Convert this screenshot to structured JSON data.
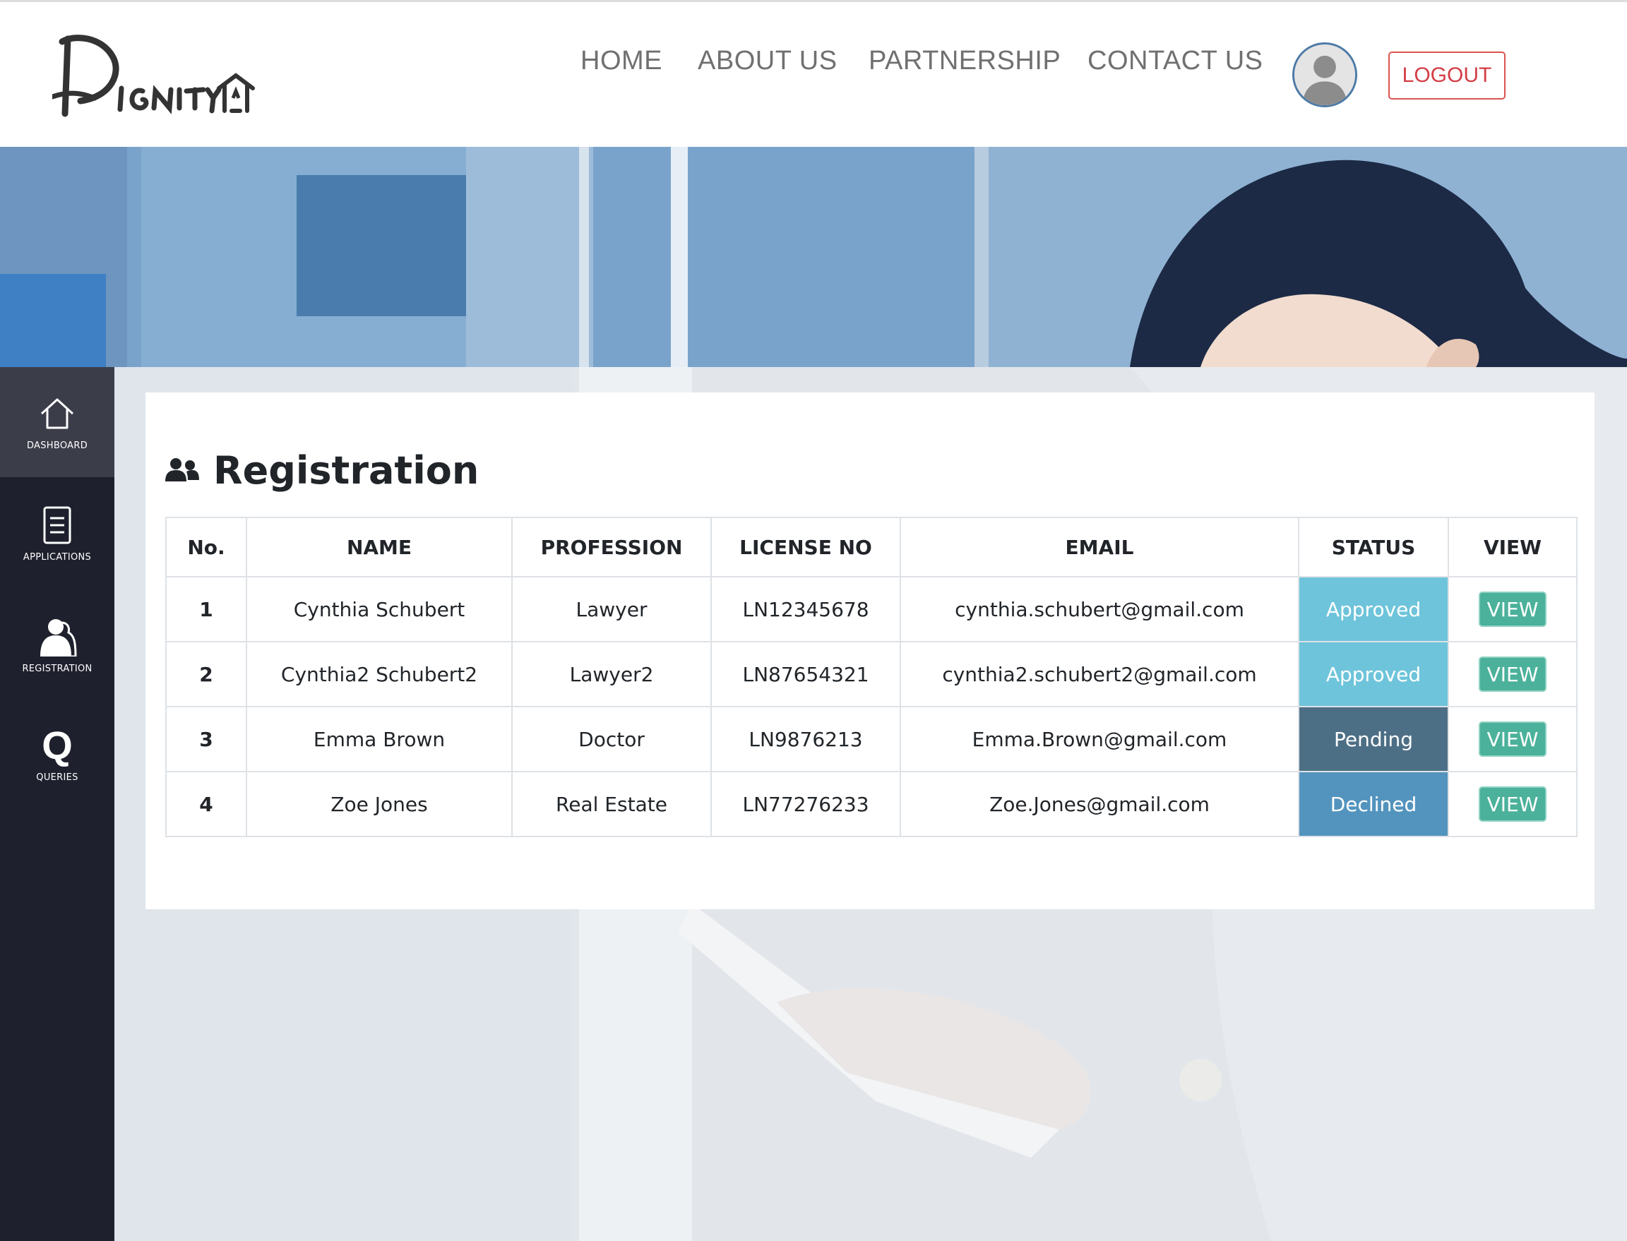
{
  "brand": {
    "logo_alt": "Dignity"
  },
  "nav": {
    "home": "HOME",
    "about": "ABOUT US",
    "partnership": "PARTNERSHIP",
    "contact": "CONTACT US",
    "logout": "LOGOUT"
  },
  "sidebar": {
    "items": [
      {
        "label": "DASHBOARD",
        "icon": "home-icon",
        "active": true
      },
      {
        "label": "APPLICATIONS",
        "icon": "document-icon",
        "active": false
      },
      {
        "label": "REGISTRATION",
        "icon": "user-icon",
        "active": false
      },
      {
        "label": "QUERIES",
        "icon": "q-icon",
        "active": false
      }
    ]
  },
  "page": {
    "title": "Registration",
    "title_icon": "users-icon"
  },
  "table": {
    "headers": [
      "No.",
      "NAME",
      "PROFESSION",
      "LICENSE NO",
      "EMAIL",
      "STATUS",
      "VIEW"
    ],
    "rows": [
      {
        "no": "1",
        "name": "Cynthia Schubert",
        "profession": "Lawyer",
        "license": "LN12345678",
        "email": "cynthia.schubert@gmail.com",
        "status": "Approved",
        "view": "VIEW"
      },
      {
        "no": "2",
        "name": "Cynthia2 Schubert2",
        "profession": "Lawyer2",
        "license": "LN87654321",
        "email": "cynthia2.schubert2@gmail.com",
        "status": "Approved",
        "view": "VIEW"
      },
      {
        "no": "3",
        "name": "Emma Brown",
        "profession": "Doctor",
        "license": "LN9876213",
        "email": "Emma.Brown@gmail.com",
        "status": "Pending",
        "view": "VIEW"
      },
      {
        "no": "4",
        "name": "Zoe Jones",
        "profession": "Real Estate",
        "license": "LN77276233",
        "email": "Zoe.Jones@gmail.com",
        "status": "Declined",
        "view": "VIEW"
      }
    ]
  },
  "colors": {
    "approved": "#6ec4da",
    "pending": "#4d6f86",
    "declined": "#5394be",
    "view_button": "#4bb19a",
    "sidebar": "#1e202d",
    "logout": "#d33d45"
  }
}
